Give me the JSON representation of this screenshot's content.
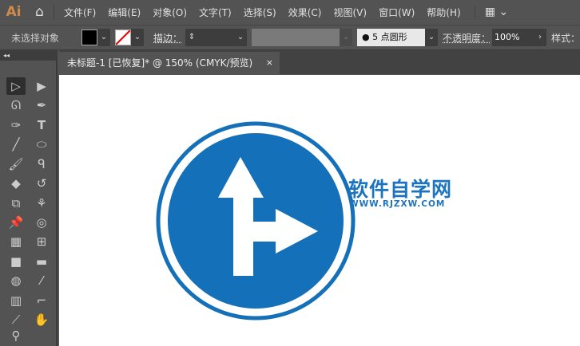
{
  "app": {
    "logo": "Ai"
  },
  "menu": [
    "文件(F)",
    "编辑(E)",
    "对象(O)",
    "文字(T)",
    "选择(S)",
    "效果(C)",
    "视图(V)",
    "窗口(W)",
    "帮助(H)"
  ],
  "control": {
    "selection": "未选择对象",
    "stroke_label": "描边：",
    "brush": "5 点圆形",
    "opacity_label": "不透明度：",
    "opacity": "100%",
    "style_label": "样式："
  },
  "tab": {
    "title": "未标题-1 [已恢复]* @ 150% (CMYK/预览)",
    "close": "×"
  },
  "watermark": {
    "title": "软件自学网",
    "url": "WWW.RJZXW.COM"
  },
  "colors": {
    "sign": "#1470b8",
    "watermark": "#1b74c0"
  }
}
